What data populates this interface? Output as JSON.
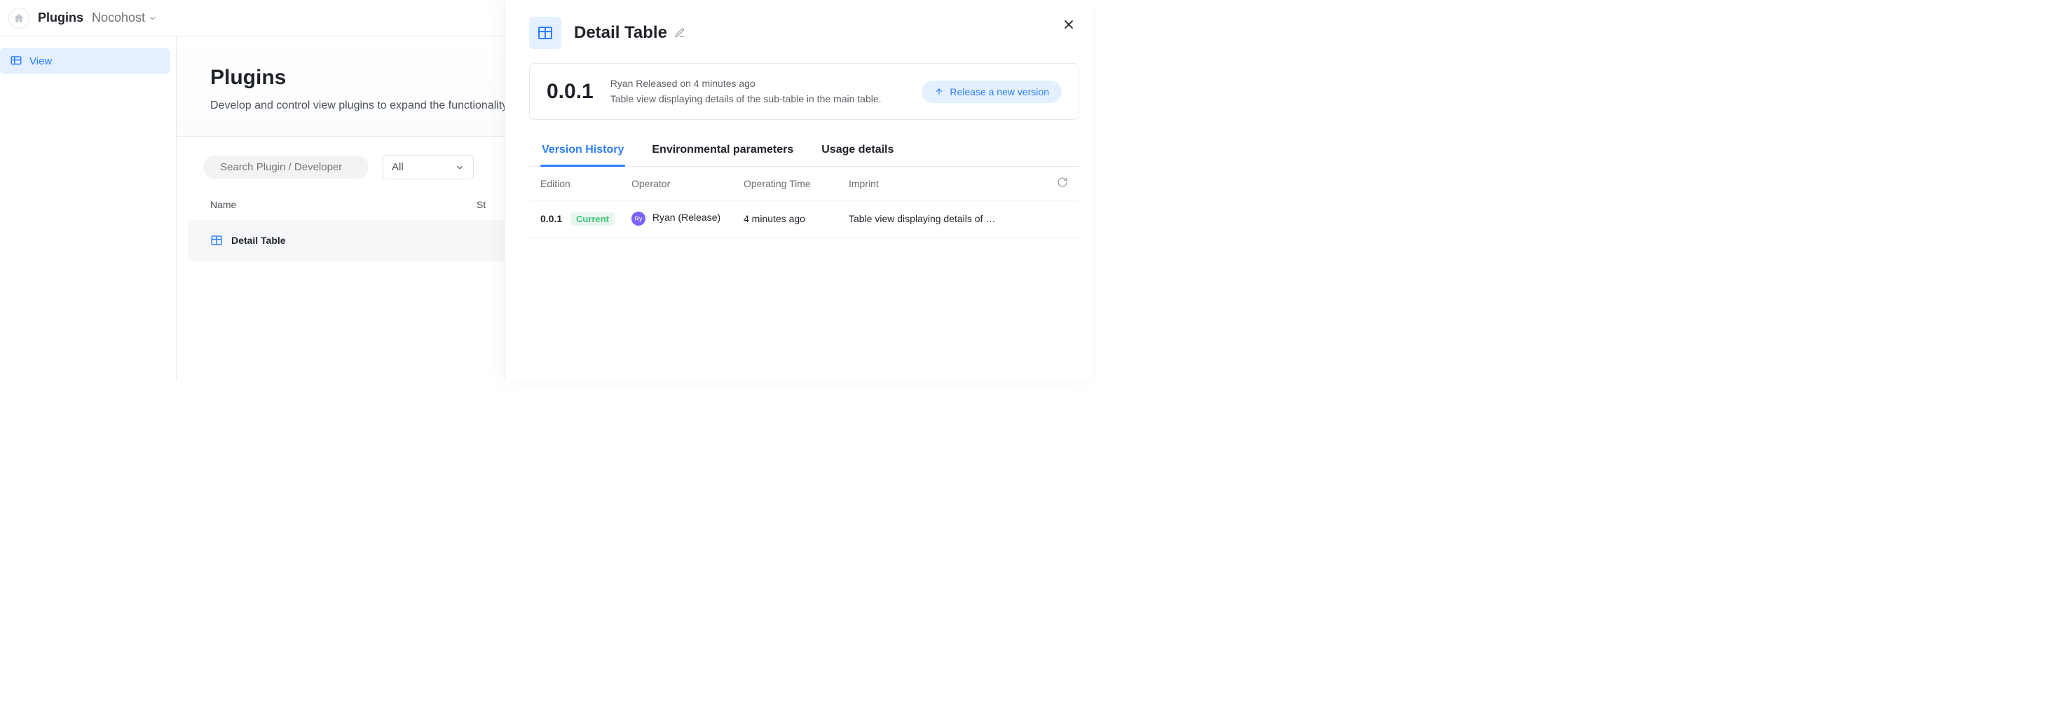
{
  "topbar": {
    "crumb1": "Plugins",
    "crumb2": "Nocohost"
  },
  "sidebar": {
    "view_label": "View"
  },
  "hero": {
    "title": "Plugins",
    "subtitle": "Develop and control view plugins to expand the functionality of the system."
  },
  "toolbar": {
    "search_placeholder": "Search Plugin / Developer",
    "filter_value": "All"
  },
  "table": {
    "col_name": "Name",
    "col_status": "St",
    "row_name": "Detail Table"
  },
  "drawer": {
    "title": "Detail Table",
    "version": "0.0.1",
    "meta_line1": "Ryan Released on 4 minutes ago",
    "meta_line2": "Table view displaying details of the sub-table in the main table.",
    "release_btn": "Release a new version",
    "tabs": {
      "history": "Version History",
      "env": "Environmental parameters",
      "usage": "Usage details"
    },
    "hist_hdr": {
      "edition": "Edition",
      "operator": "Operator",
      "time": "Operating Time",
      "imprint": "Imprint"
    },
    "hist_row": {
      "edition": "0.0.1",
      "badge": "Current",
      "avatar_initials": "Ry",
      "operator": "Ryan (Release)",
      "time": "4 minutes ago",
      "imprint": "Table view displaying details of t…"
    }
  }
}
